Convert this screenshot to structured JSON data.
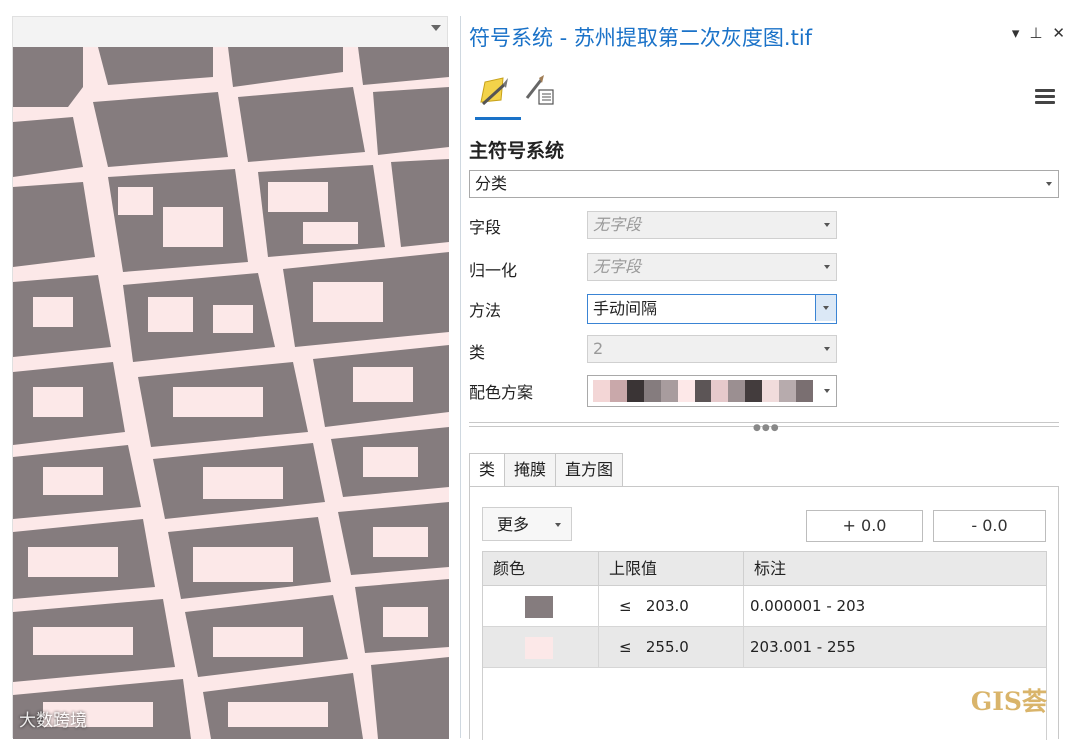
{
  "pane": {
    "title": "符号系统 - 苏州提取第二次灰度图.tif",
    "controls": {
      "pin": "▾",
      "autohide": "⊥",
      "close": "✕"
    }
  },
  "primary": {
    "section_title": "主符号系统",
    "renderer": "分类"
  },
  "fields": {
    "field_label": "字段",
    "field_value": "无字段",
    "normalize_label": "归一化",
    "normalize_value": "无字段",
    "method_label": "方法",
    "method_value": "手动间隔",
    "classes_label": "类",
    "classes_value": "2",
    "ramp_label": "配色方案"
  },
  "tabs": {
    "classes": "类",
    "mask": "掩膜",
    "histogram": "直方图"
  },
  "toolbar": {
    "more": "更多",
    "plus": "+ 0.0",
    "minus": "- 0.0"
  },
  "grid": {
    "headers": {
      "color": "颜色",
      "upper": "上限值",
      "label": "标注"
    },
    "rows": [
      {
        "op": "≤",
        "upper": "203.0",
        "label": "0.000001 - 203",
        "color": "#857c7e"
      },
      {
        "op": "≤",
        "upper": "255.0",
        "label": "203.001 - 255",
        "color": "#fce8e8"
      }
    ]
  },
  "colors": {
    "map_dark": "#857c7e",
    "map_light": "#fce8e8",
    "accent": "#1a72c8"
  },
  "ramp_colors": [
    "#f3d6d6",
    "#c9a8aa",
    "#3a3435",
    "#857c7e",
    "#a89c9e",
    "#fde8e8",
    "#5c5556",
    "#e6c9cb",
    "#9b8f91",
    "#433c3d",
    "#f1dcdc",
    "#b7abad",
    "#7a6f71"
  ],
  "watermarks": {
    "left": "大数跨境",
    "right": "GIS荟"
  }
}
